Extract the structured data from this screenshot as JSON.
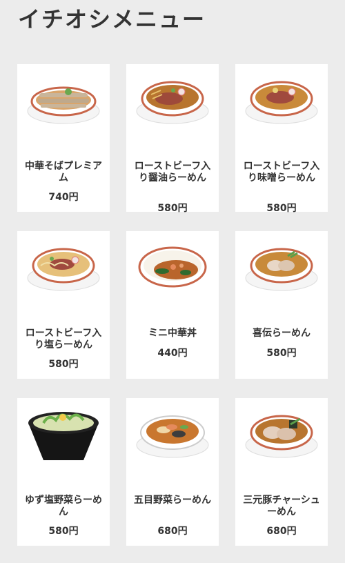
{
  "page": {
    "title": "イチオシメニュー"
  },
  "menu": [
    {
      "name": "中華そばプレミアム",
      "price": "740円"
    },
    {
      "name": "ローストビーフ入り醤油らーめん",
      "price": "580円"
    },
    {
      "name": "ローストビーフ入り味噌らーめん",
      "price": "580円"
    },
    {
      "name": "ローストビーフ入り塩らーめん",
      "price": "580円"
    },
    {
      "name": "ミニ中華丼",
      "price": "440円"
    },
    {
      "name": "喜伝らーめん",
      "price": "580円"
    },
    {
      "name": "ゆず塩野菜らーめん",
      "price": "580円"
    },
    {
      "name": "五目野菜らーめん",
      "price": "680円"
    },
    {
      "name": "三元豚チャーシューめん",
      "price": "680円"
    }
  ],
  "colors": {
    "background": "#ececec",
    "card": "#ffffff",
    "text": "#333333",
    "bowl_rim": "#c8664a"
  }
}
